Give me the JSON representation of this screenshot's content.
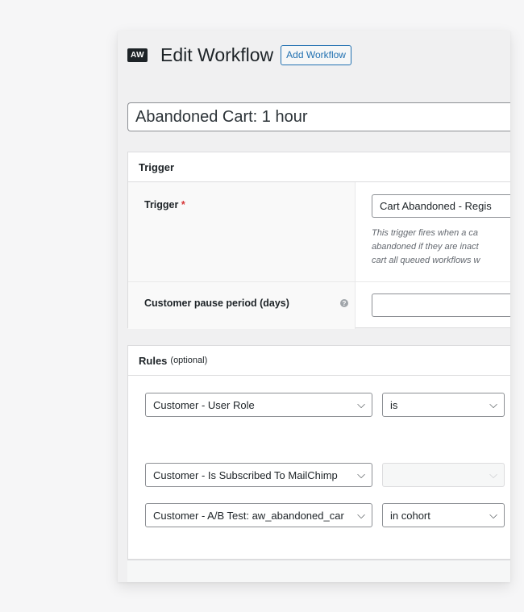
{
  "header": {
    "logo": "AW",
    "title": "Edit Workflow",
    "add_button": "Add Workflow"
  },
  "workflow_title": "Abandoned Cart: 1 hour",
  "trigger_section": {
    "heading": "Trigger",
    "trigger_label": "Trigger",
    "required_mark": "*",
    "trigger_value": "Cart Abandoned - Regis",
    "description_lines": [
      "This trigger fires when a ca",
      "abandoned if they are inact",
      "cart all queued workflows w"
    ],
    "pause_label": "Customer pause period (days)",
    "pause_help": "?",
    "pause_value": ""
  },
  "rules_section": {
    "heading": "Rules",
    "optional": "(optional)",
    "rules": [
      {
        "field": "Customer - User Role",
        "operator": "is"
      },
      {
        "field": "Customer - Is Subscribed To MailChimp",
        "operator": ""
      },
      {
        "field": "Customer - A/B Test: aw_abandoned_car",
        "operator": "in cohort"
      }
    ]
  },
  "icons": {
    "chevron": "chevron-down-icon",
    "help": "help-icon"
  },
  "colors": {
    "accent": "#2271b1",
    "required": "#d63638"
  }
}
